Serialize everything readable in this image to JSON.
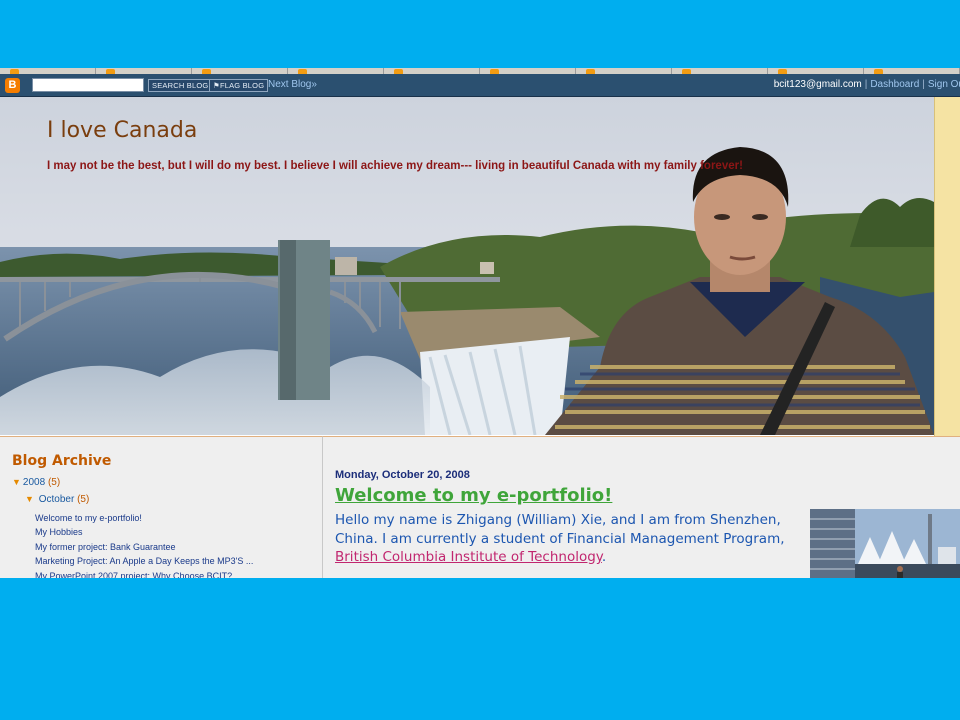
{
  "navbar": {
    "logo_glyph": "B",
    "search_button": "SEARCH BLOG",
    "flag_button": "FLAG BLOG",
    "next_blog": "Next Blog»",
    "user_email": "bcit123@gmail.com",
    "separator": "|",
    "dashboard": "Dashboard",
    "sign_out": "Sign Ou"
  },
  "header": {
    "title": "I love Canada",
    "description": "I may not be the best, but I will do my best. I believe I will achieve my dream--- living in beautiful Canada with my family forever!"
  },
  "sidebar": {
    "title": "Blog Archive",
    "year": {
      "label": "2008",
      "count": "(5)"
    },
    "month": {
      "label": "October",
      "count": "(5)"
    },
    "posts": [
      "Welcome to my e-portfolio!",
      "My Hobbies",
      "My former project: Bank Guarantee",
      "Marketing Project: An Apple a Day Keeps the MP3'S ...",
      "My PowerPoint 2007 project: Why Choose BCIT?"
    ]
  },
  "post": {
    "date": "Monday, October 20, 2008",
    "title": "Welcome to my e-portfolio!",
    "body": "Hello my name is Zhigang (William) Xie, and I am from Shenzhen, China. I am currently a student of Financial Management Program, ",
    "link": "British Columbia Institute of Technology",
    "end": "."
  },
  "colors": {
    "background": "#00aeef",
    "navbar": "#2b5070",
    "title_brown": "#7a3e0e",
    "description_red": "#8c1616",
    "archive_orange": "#c05a00",
    "post_title_green": "#3fa53a",
    "body_blue": "#1c56b0",
    "link_pink": "#c1266f"
  },
  "icons": {
    "blogger": "blogger-logo-icon",
    "expand": "triangle-down-icon"
  }
}
